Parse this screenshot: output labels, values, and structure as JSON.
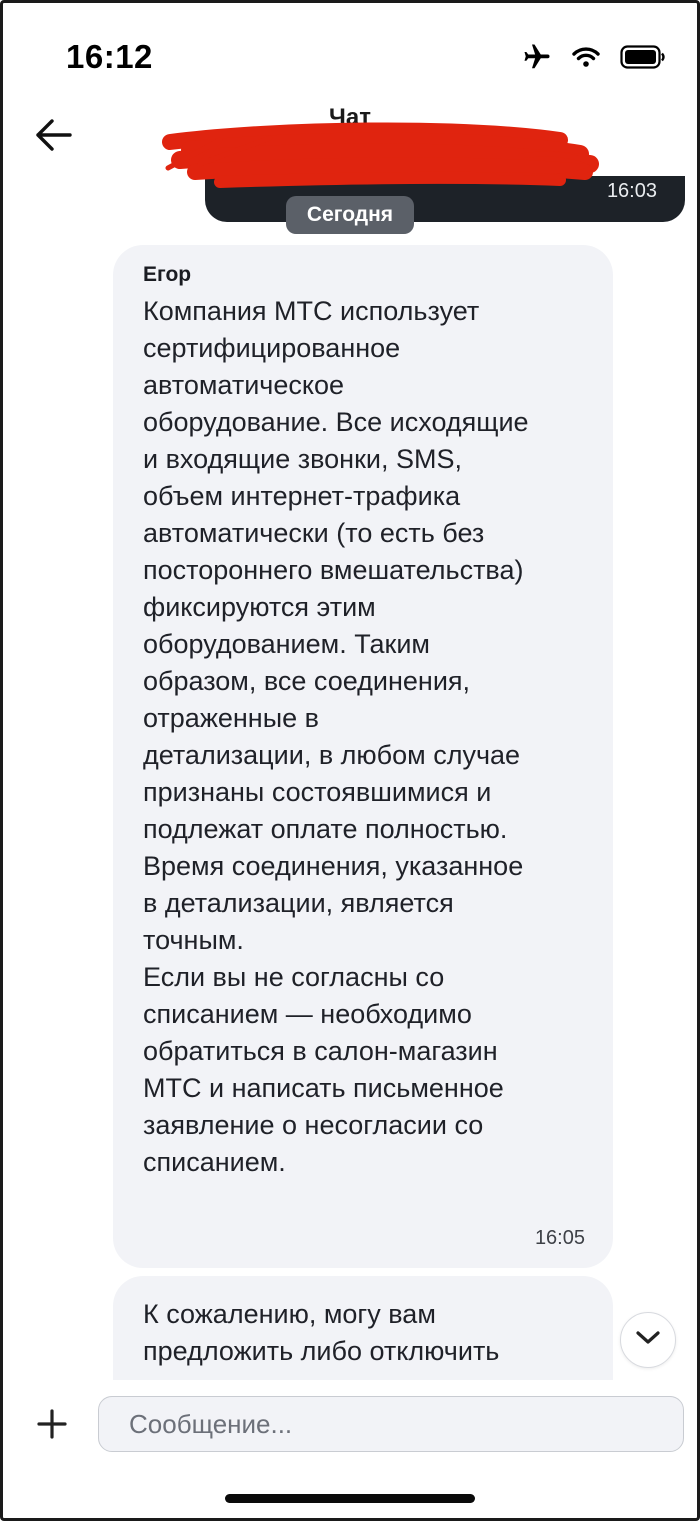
{
  "status_bar": {
    "time": "16:12",
    "icons": [
      "airplane-icon",
      "wifi-icon",
      "battery-icon"
    ]
  },
  "header": {
    "title": "Чат",
    "back_icon": "arrow-left-icon"
  },
  "previous_message": {
    "time": "16:03"
  },
  "date_divider": "Сегодня",
  "messages": [
    {
      "sender": "Егор",
      "text": "Компания МТС использует\nсертифицированное\nавтоматическое\nоборудование. Все исходящие\nи входящие звонки, SMS,\nобъем интернет-трафика\nавтоматически (то есть без\nпостороннего вмешательства)\nфиксируются этим\nоборудованием. Таким\nобразом, все соединения,\nотраженные в\nдетализации, в любом случае\nпризнаны состоявшимися и\nподлежат оплате полностью.\nВремя соединения, указанное\nв детализации, является\nточным.\nЕсли вы не согласны со\nсписанием — необходимо\nобратиться в салон-магазин\nМТС и написать письменное\nзаявление о несогласии со\nсписанием.",
      "time": "16:05"
    },
    {
      "text": "К сожалению, могу вам\nпредложить либо отключить"
    }
  ],
  "composer": {
    "placeholder": "Сообщение..."
  },
  "colors": {
    "incoming_bubble": "#f2f3f7",
    "outgoing_bubble": "#1d2228",
    "date_chip": "#5b6068",
    "redaction": "#e0240f"
  }
}
